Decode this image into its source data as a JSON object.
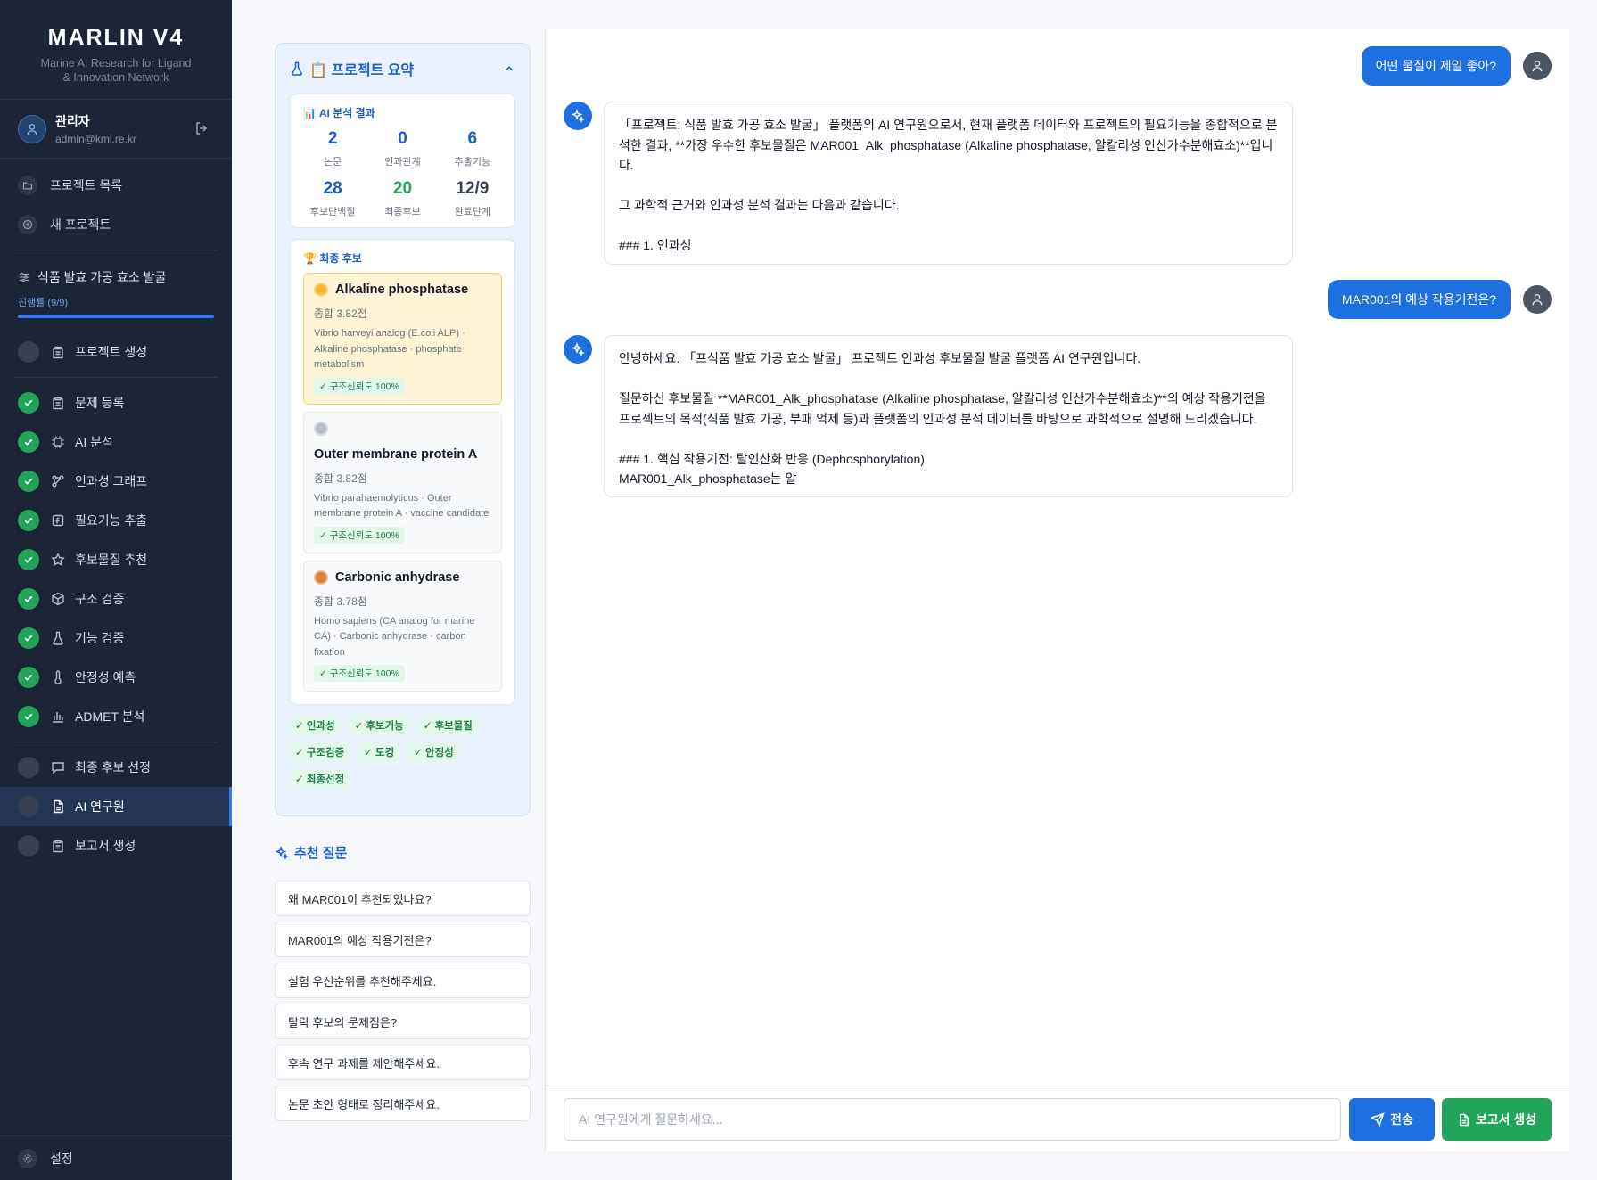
{
  "brand": {
    "title": "MARLIN V4",
    "subtitle_line1": "Marine AI Research for Ligand",
    "subtitle_line2": "& Innovation Network"
  },
  "user": {
    "name": "관리자",
    "email": "admin@kmi.re.kr"
  },
  "nav": {
    "project_list": "프로젝트 목록",
    "new_project": "새 프로젝트"
  },
  "project": {
    "name": "식품 발효 가공 효소 발굴",
    "progress_label": "진행률 (9/9)",
    "progress": 1.0
  },
  "steps": [
    {
      "label": "프로젝트 생성",
      "icon": "clipboard-icon",
      "done": false
    },
    {
      "label": "문제 등록",
      "icon": "clipboard-icon",
      "done": true
    },
    {
      "label": "AI 분석",
      "icon": "cpu-icon",
      "done": true
    },
    {
      "label": "인과성 그래프",
      "icon": "graph-icon",
      "done": true
    },
    {
      "label": "필요기능 추출",
      "icon": "function-icon",
      "done": true
    },
    {
      "label": "후보물질 추천",
      "icon": "star-icon",
      "done": true
    },
    {
      "label": "구조 검증",
      "icon": "cube-icon",
      "done": true
    },
    {
      "label": "기능 검증",
      "icon": "flask-icon",
      "done": true
    },
    {
      "label": "안정성 예측",
      "icon": "thermometer-icon",
      "done": true
    },
    {
      "label": "ADMET 분석",
      "icon": "bar-chart-icon",
      "done": true
    },
    {
      "label": "최종 후보 선정",
      "icon": "message-icon",
      "done": false
    },
    {
      "label": "AI 연구원",
      "icon": "document-icon",
      "done": false,
      "active": true
    },
    {
      "label": "보고서 생성",
      "icon": "clipboard-icon",
      "done": false
    }
  ],
  "settings_label": "설정",
  "summary": {
    "title": "📋 프로젝트 요약",
    "analysis_title": "📊 AI 분석 결과",
    "stats": [
      {
        "value": "2",
        "label": "논문",
        "color": "blue"
      },
      {
        "value": "0",
        "label": "인과관계",
        "color": "blue"
      },
      {
        "value": "6",
        "label": "추출기능",
        "color": "blue"
      },
      {
        "value": "28",
        "label": "후보단백질",
        "color": "blue"
      },
      {
        "value": "20",
        "label": "최종후보",
        "color": "green"
      },
      {
        "value": "12/9",
        "label": "완료단계",
        "color": "gray"
      }
    ],
    "final_title": "🏆 최종 후보",
    "candidates": [
      {
        "rank": "gold",
        "name": "Alkaline phosphatase",
        "score": "종합 3.82점",
        "desc": "Vibrio harveyi analog (E.coli ALP) · Alkaline phosphatase · phosphate metabolism",
        "badge": "✓ 구조신뢰도 100%"
      },
      {
        "rank": "silver",
        "name": "Outer membrane protein A",
        "score": "종합 3.82점",
        "desc": "Vibrio parahaemolyticus · Outer membrane protein A · vaccine candidate",
        "badge": "✓ 구조신뢰도 100%"
      },
      {
        "rank": "bronze",
        "name": "Carbonic anhydrase",
        "score": "종합 3.78점",
        "desc": "Homo sapiens (CA analog for marine CA) · Carbonic anhydrase · carbon fixation",
        "badge": "✓ 구조신뢰도 100%"
      }
    ],
    "tags": [
      "✓ 인과성",
      "✓ 후보기능",
      "✓ 후보물질",
      "✓ 구조검증",
      "✓ 도킹",
      "✓ 안정성",
      "✓ 최종선정"
    ]
  },
  "suggestions": {
    "title": "추천 질문",
    "items": [
      "왜 MAR001이 추천되었나요?",
      "MAR001의 예상 작용기전은?",
      "실험 우선순위를 추천해주세요.",
      "탈락 후보의 문제점은?",
      "후속 연구 과제를 제안해주세요.",
      "논문 초안 형태로 정리해주세요."
    ]
  },
  "chat": {
    "messages": [
      {
        "role": "user",
        "text": "어떤 물질이 제일 좋아?"
      },
      {
        "role": "ai",
        "text": "「프로젝트: 식품 발효 가공 효소 발굴」 플랫폼의 AI 연구원으로서, 현재 플랫폼 데이터와 프로젝트의 필요기능을 종합적으로 분석한 결과, **가장 우수한 후보물질은 MAR001_Alk_phosphatase (Alkaline phosphatase, 알칼리성 인산가수분해효소)**입니다.\n\n그 과학적 근거와 인과성 분석 결과는 다음과 같습니다.\n\n### 1. 인과성"
      },
      {
        "role": "user",
        "text": "MAR001의 예상 작용기전은?"
      },
      {
        "role": "ai",
        "text": "안녕하세요. 「프식품 발효 가공 효소 발굴」 프로젝트 인과성 후보물질 발굴 플랫폼 AI 연구원입니다.\n\n질문하신 후보물질 **MAR001_Alk_phosphatase (Alkaline phosphatase, 알칼리성 인산가수분해효소)**의 예상 작용기전을 프로젝트의 목적(식품 발효 가공, 부패 억제 등)과 플랫폼의 인과성 분석 데이터를 바탕으로 과학적으로 설명해 드리겠습니다.\n\n### 1. 핵심 작용기전: 탈인산화 반응 (Dephosphorylation)\nMAR001_Alk_phosphatase는 알"
      }
    ],
    "input_placeholder": "AI 연구원에게 질문하세요...",
    "send_label": "전송",
    "report_label": "보고서 생성"
  },
  "colors": {
    "primary": "#1e6fe0",
    "success": "#22a55a",
    "sidebar_bg": "#1c2536",
    "gold": "#f5b82e",
    "silver": "#b8bec8",
    "bronze": "#d98036"
  }
}
